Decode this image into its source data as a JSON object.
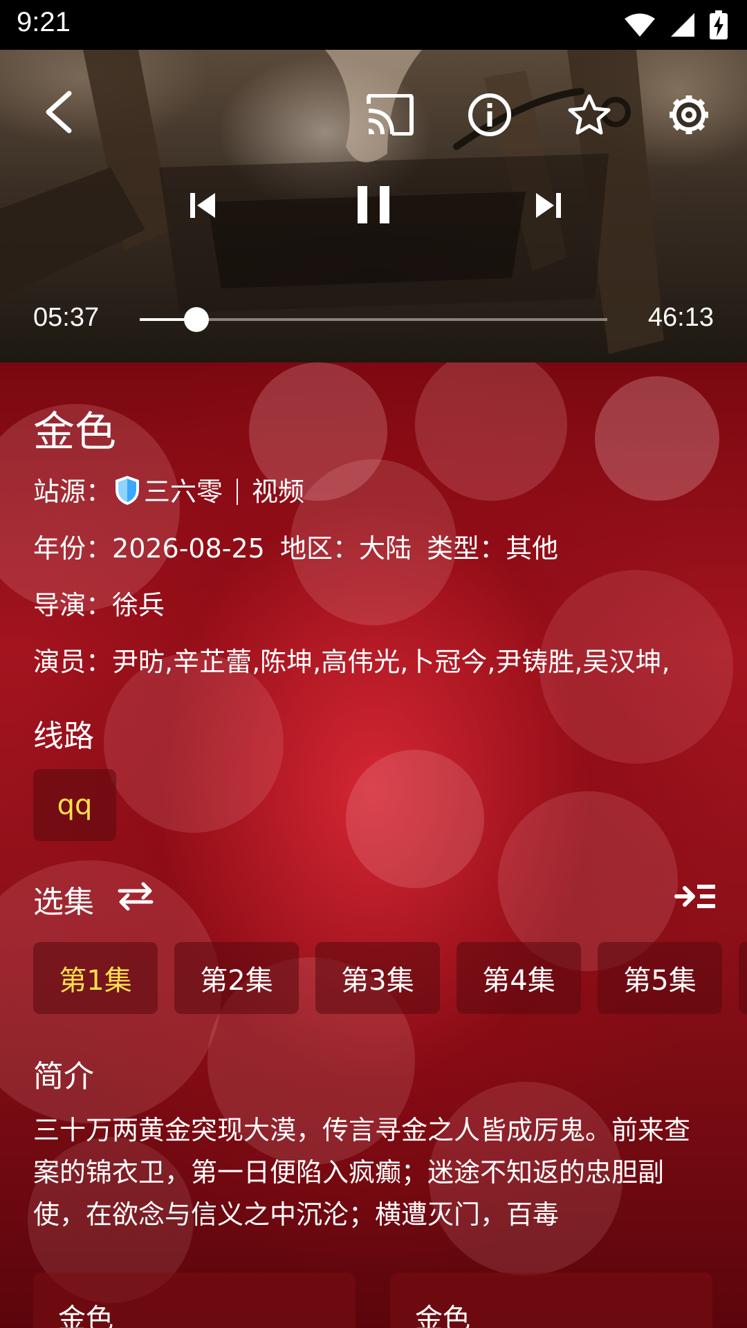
{
  "status_bar": {
    "time": "9:21"
  },
  "player": {
    "current_time": "05:37",
    "total_time": "46:13",
    "progress": 0.121
  },
  "detail": {
    "title": "金色",
    "source_label": "站源：",
    "source_name": "三六零",
    "source_tag": "视频",
    "year_label": "年份：",
    "year": "2026-08-25",
    "region_label": "地区：",
    "region": "大陆",
    "genre_label": "类型：",
    "genre": "其他",
    "director_label": "导演：",
    "director": "徐兵",
    "cast_label": "演员：",
    "cast": "尹昉,辛芷蕾,陈坤,高伟光,卜冠今,尹铸胜,吴汉坤,",
    "lines_title": "线路",
    "lines": [
      {
        "label": "qq",
        "selected": true
      }
    ],
    "episodes_title": "选集",
    "episodes": [
      {
        "label": "第1集",
        "selected": true
      },
      {
        "label": "第2集",
        "selected": false
      },
      {
        "label": "第3集",
        "selected": false
      },
      {
        "label": "第4集",
        "selected": false
      },
      {
        "label": "第5集",
        "selected": false
      }
    ],
    "synopsis_title": "简介",
    "synopsis": "三十万两黄金突现大漠，传言寻金之人皆成厉鬼。前来查案的锦衣卫，第一日便陷入疯癫；迷途不知返的忠胆副使，在欲念与信义之中沉沦；横遭灭门，百毒",
    "related": [
      {
        "label": "金色"
      },
      {
        "label": "金色"
      }
    ]
  },
  "colors": {
    "accent_yellow": "#ffe14d",
    "background_red": "#a3141f",
    "chip_bg": "#5a0a0e"
  }
}
